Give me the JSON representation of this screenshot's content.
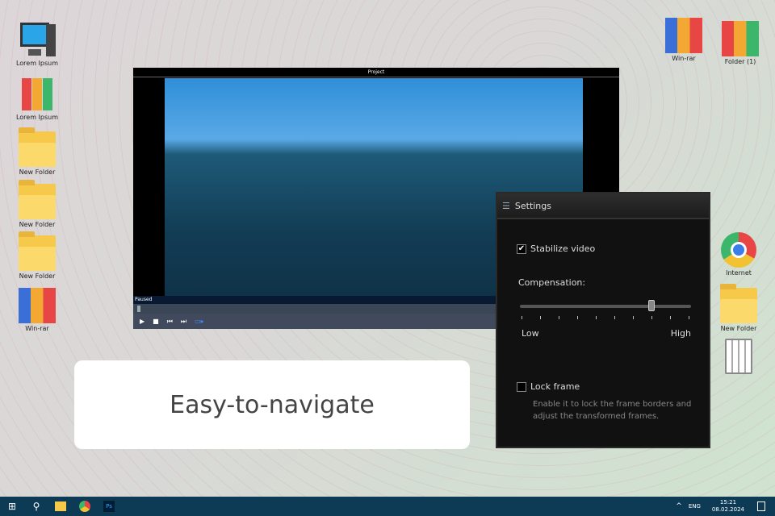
{
  "desktop_icons_left": [
    "Lorem Ipsum",
    "Lorem Ipsum",
    "New Folder",
    "New Folder",
    "New Folder",
    "Win-rar"
  ],
  "desktop_icons_right": {
    "winrar": "Win-rar",
    "folder1": "Folder (1)",
    "internet": "Internet",
    "new_folder": "New Folder"
  },
  "player": {
    "title": "Project",
    "status": "Paused",
    "progress_percent": 1
  },
  "settings": {
    "title": "Settings",
    "stabilize_label": "Stabilize video",
    "stabilize_checked": true,
    "compensation_label": "Compensation:",
    "compensation_value_percent": 77,
    "low": "Low",
    "high": "High",
    "lock_label": "Lock frame",
    "lock_checked": false,
    "lock_desc": "Enable it to lock the frame borders and adjust the transformed frames."
  },
  "card": {
    "text": "Easy-to-navigate"
  },
  "taskbar": {
    "lang": "ENG",
    "time": "15:21",
    "date": "08.02.2024"
  }
}
